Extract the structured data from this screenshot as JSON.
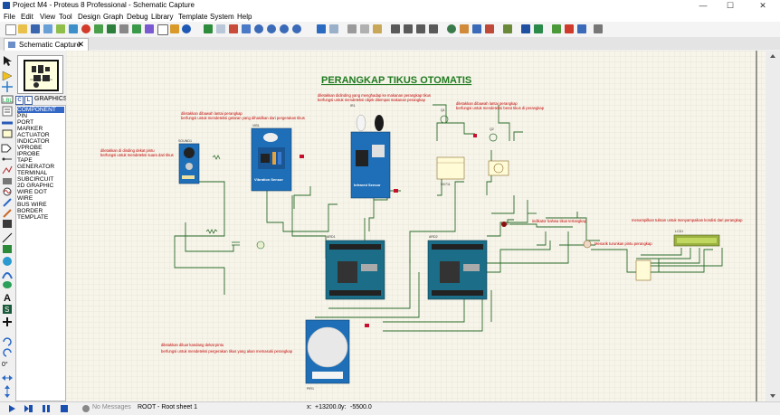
{
  "window": {
    "title": "Project M4 - Proteus 8 Professional - Schematic Capture",
    "minimize": "—",
    "maximize": "☐",
    "close": "✕"
  },
  "menu": [
    "File",
    "Edit",
    "View",
    "Tool",
    "Design",
    "Graph",
    "Debug",
    "Library",
    "Template",
    "System",
    "Help"
  ],
  "tab": {
    "label": "Schematic Capture",
    "close": "✕"
  },
  "panel": {
    "btn_c": "C",
    "btn_l": "L",
    "header": "GRAPHICS"
  },
  "modes": [
    "COMPONENT",
    "PIN",
    "PORT",
    "MARKER",
    "ACTUATOR",
    "INDICATOR",
    "VPROBE",
    "IPROBE",
    "TAPE",
    "GENERATOR",
    "TERMINAL",
    "SUBCIRCUIT",
    "2D GRAPHIC",
    "WIRE DOT",
    "WIRE",
    "BUS WIRE",
    "BORDER",
    "TEMPLATE"
  ],
  "rotation": "0°",
  "schematic": {
    "title": "PERANGKAP TIKUS OTOMATIS",
    "notes": {
      "sound": [
        "diletakkan di dinding dekat pintu",
        "berfungsi untuk mendeteksi suara dari tikus"
      ],
      "vibration": [
        "diletakkan dibawah lantai perangkap",
        "berfungsi untuk mendeteksi getaran yang dihasilkan dari pergerakan tikus"
      ],
      "infrared": [
        "diletakkan didinding yang menghadap ke makanan perangkap tikus",
        "berfungsi untuk mendeteksi objek ditempat makanan perangkap"
      ],
      "weight": [
        "diletakkan dibawah lantai perangkap",
        "berfungsi untuk mendeteksi berat tikus di perangkap"
      ],
      "led": "indikator bahwa tikus tertangkap",
      "motor": "Menarik turunkan pintu perangkap",
      "lcd": "menampilkan tulisan untuk menyampaikan kondisi dari perangkap",
      "pir": [
        "diletakkan diluar kandang dekat pintu",
        "berfungsi untuk mendeteksi pergerakan tikus yang akan memasuki perangkap"
      ]
    },
    "parts": {
      "sound": "SOUND1",
      "vibration": "VIB1",
      "vibration_label": "Vibration Sensor",
      "infrared": "IR1",
      "infrared_label": "Infrared Sensor",
      "loadcell": "HX711",
      "arduino1": "ARD1",
      "arduino2": "ARD2",
      "lcd": "LCD1",
      "pir": "PIR1",
      "q1": "Q1",
      "q2": "Q2"
    }
  },
  "status": {
    "messages": "No Messages",
    "sheet": "ROOT - Root sheet 1",
    "x_label": "x:",
    "x_value": "+13200.0",
    "y_label": "y:",
    "y_value": "-5500.0"
  },
  "colors": {
    "sheet": "#f5f3e9",
    "grid": "#d8d6c8",
    "wire": "#2a6a2a",
    "text_red": "#c00000",
    "title": "#1f7a1f",
    "module_blue": "#1e6fb8",
    "arduino": "#1b6d88",
    "selected": "#3468c6"
  }
}
